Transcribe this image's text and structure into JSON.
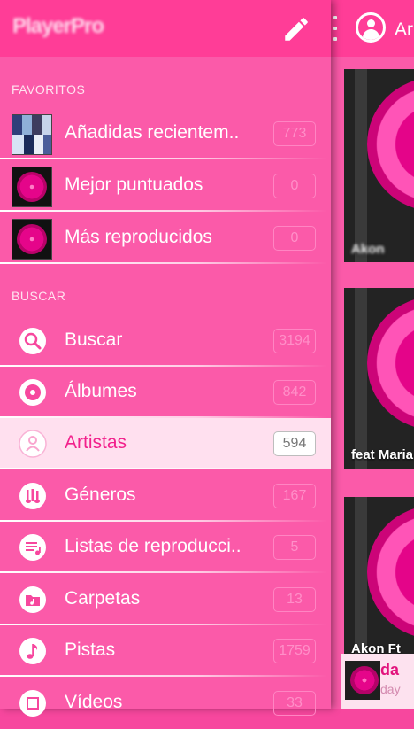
{
  "drawer": {
    "app_title": "PlayerPro",
    "favorites_header": "FAVORITOS",
    "favorites": [
      {
        "label": "Añadidas recientem..",
        "count": "773",
        "thumb": "album-mosaic"
      },
      {
        "label": "Mejor puntuados",
        "count": "0",
        "thumb": "pink-disc"
      },
      {
        "label": "Más reproducidos",
        "count": "0",
        "thumb": "pink-disc"
      }
    ],
    "browse_header": "BUSCAR",
    "browse": [
      {
        "label": "Buscar",
        "count": "3194",
        "icon": "search-icon"
      },
      {
        "label": "Álbumes",
        "count": "842",
        "icon": "album-disc-icon"
      },
      {
        "label": "Artistas",
        "count": "594",
        "icon": "artist-person-icon",
        "active": true
      },
      {
        "label": "Géneros",
        "count": "167",
        "icon": "genre-instruments-icon"
      },
      {
        "label": "Listas de reproducci..",
        "count": "5",
        "icon": "playlist-icon"
      },
      {
        "label": "Carpetas",
        "count": "13",
        "icon": "folder-music-icon"
      },
      {
        "label": "Pistas",
        "count": "1759",
        "icon": "music-note-icon"
      },
      {
        "label": "Vídeos",
        "count": "33",
        "icon": "video-film-icon"
      }
    ]
  },
  "background": {
    "title": "Ar",
    "tiles": [
      {
        "caption": "Akon"
      },
      {
        "caption": "feat Maria"
      },
      {
        "caption": "Akon Ft"
      }
    ],
    "now_playing": {
      "title": "da",
      "subtitle": "day"
    }
  },
  "colors": {
    "header": "#ff3d97",
    "panel": "#fb5aa9",
    "active_row": "#ffe0ef",
    "active_text": "#f2208c"
  }
}
